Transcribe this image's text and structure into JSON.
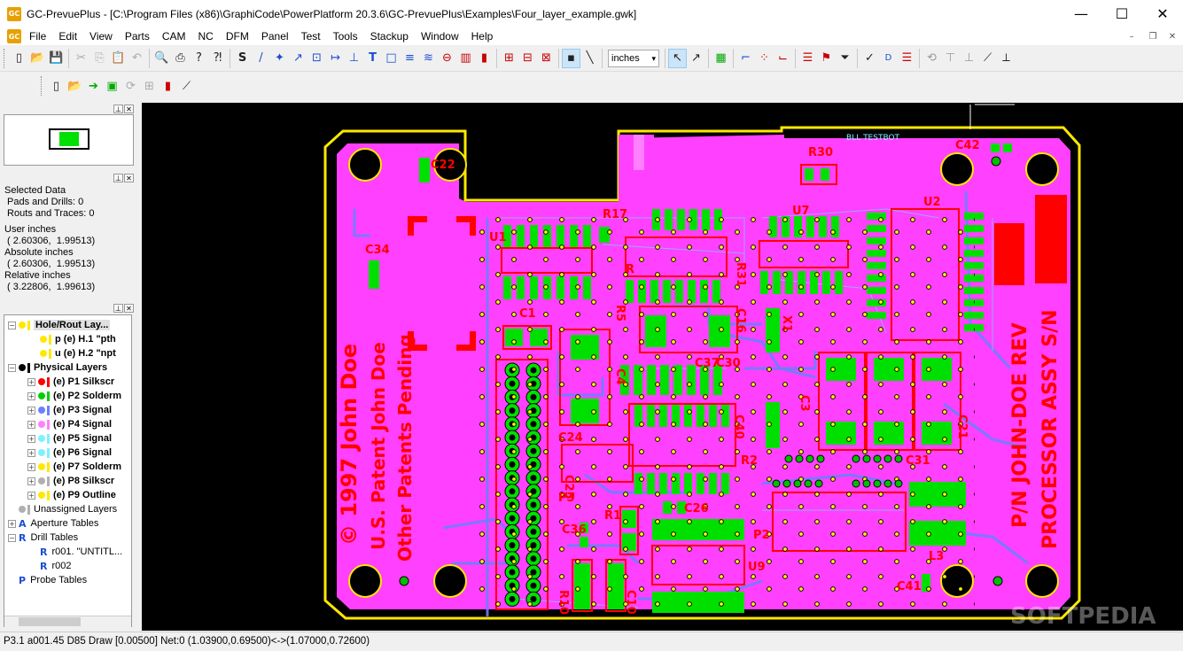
{
  "window": {
    "logo": "GC",
    "title": "GC-PrevuePlus - [C:\\Program Files (x86)\\GraphiCode\\PowerPlatform 20.3.6\\GC-PrevuePlus\\Examples\\Four_layer_example.gwk]",
    "minimize": "—",
    "maximize": "☐",
    "close": "✕"
  },
  "menu": [
    "File",
    "Edit",
    "View",
    "Parts",
    "CAM",
    "NC",
    "DFM",
    "Panel",
    "Test",
    "Tools",
    "Stackup",
    "Window",
    "Help"
  ],
  "toolbar": {
    "units_value": "inches",
    "units_arrow": "▾",
    "icons_row1a": [
      "▯",
      "📂",
      "💾"
    ],
    "icons_row1b": [
      "✂",
      "⎘",
      "📋",
      "↶"
    ],
    "icons_row1c": [
      "🔍",
      "⎙",
      "?",
      "⁈"
    ],
    "icons_row1d": [
      "S",
      "/",
      "✦",
      "↗",
      "⊡",
      "↦",
      "⊥",
      "T",
      "□",
      "≡",
      "≋",
      "⊖",
      "▥",
      "▮"
    ],
    "icons_row1e": [
      "⊞",
      "⊟",
      "⊠"
    ],
    "icons_row1f": [
      "▪",
      "╲"
    ],
    "icons_row1g": [
      "↖",
      "↗"
    ],
    "icons_row1h": [
      "▦"
    ],
    "icons_row1i": [
      "⌐",
      "⁘",
      "⌙"
    ],
    "icons_row1j": [
      "☰",
      "⚑",
      "⏷"
    ],
    "icons_row1k": [
      "✓",
      "D",
      "☰"
    ],
    "icons_row1l": [
      "⟲",
      "⊤",
      "⊥",
      "⟋",
      "⟂"
    ],
    "icons_row2": [
      "▯",
      "📂",
      "➔",
      "▣",
      "⟳",
      "⊞",
      "▮",
      "⟋"
    ]
  },
  "mdi": {
    "min": "–",
    "restore": "❐",
    "close": "✕"
  },
  "panels": {
    "pin": "⊥",
    "close": "✕"
  },
  "selected_info": [
    "Selected Data",
    " Pads and Drills: 0",
    " Routs and Traces: 0",
    "User inches",
    " ( 2.60306,  1.99513)",
    "Absolute inches",
    " ( 2.60306,  1.99513)",
    "Relative inches",
    " ( 3.22806,  1.99613)"
  ],
  "tree": [
    {
      "label": "Hole/Rout Lay...",
      "color": "#ffe800",
      "bold": true,
      "level": 0,
      "exp": "−"
    },
    {
      "label": "p (e) H.1 \"pth",
      "color": "#ffe800",
      "bold": true,
      "level": 1,
      "exp": ""
    },
    {
      "label": "u (e) H.2 \"npt",
      "color": "#ffe800",
      "bold": true,
      "level": 1,
      "exp": ""
    },
    {
      "label": "Physical Layers",
      "color": "#000000",
      "bold": true,
      "level": 0,
      "exp": "−"
    },
    {
      "label": "(e) P1 Silkscr",
      "color": "#ff0000",
      "bold": true,
      "level": 1,
      "exp": "+"
    },
    {
      "label": "(e) P2 Solderm",
      "color": "#00d000",
      "bold": true,
      "level": 1,
      "exp": "+"
    },
    {
      "label": "(e) P3 Signal",
      "color": "#6a80ff",
      "bold": true,
      "level": 1,
      "exp": "+"
    },
    {
      "label": "(e) P4 Signal",
      "color": "#ff80ff",
      "bold": true,
      "level": 1,
      "exp": "+"
    },
    {
      "label": "(e) P5 Signal",
      "color": "#80f0ff",
      "bold": true,
      "level": 1,
      "exp": "+"
    },
    {
      "label": "(e) P6 Signal",
      "color": "#80f0ff",
      "bold": true,
      "level": 1,
      "exp": "+"
    },
    {
      "label": "(e) P7 Solderm",
      "color": "#ffe800",
      "bold": true,
      "level": 1,
      "exp": "+"
    },
    {
      "label": "(e) P8 Silkscr",
      "color": "#b0b0b0",
      "bold": true,
      "level": 1,
      "exp": "+"
    },
    {
      "label": "(e) P9 Outline",
      "color": "#ffe800",
      "bold": true,
      "level": 1,
      "exp": "+"
    },
    {
      "label": "Unassigned Layers",
      "color": "#b0b0b0",
      "bold": false,
      "level": 0,
      "exp": ""
    },
    {
      "label": "Aperture Tables",
      "color": "",
      "bold": false,
      "level": 0,
      "exp": "+",
      "icon": "A"
    },
    {
      "label": "Drill Tables",
      "color": "",
      "bold": false,
      "level": 0,
      "exp": "−",
      "icon": "R"
    },
    {
      "label": "r001. \"UNTITL...",
      "color": "",
      "bold": false,
      "level": 1,
      "exp": "",
      "icon": "R"
    },
    {
      "label": "r002",
      "color": "",
      "bold": false,
      "level": 1,
      "exp": "",
      "icon": "R"
    },
    {
      "label": "Probe Tables",
      "color": "",
      "bold": false,
      "level": 0,
      "exp": "",
      "icon": "P"
    }
  ],
  "pcb": {
    "silk": [
      {
        "t": "U1",
        "c": "u1"
      },
      {
        "t": "C22",
        "c": "c22"
      },
      {
        "t": "C34",
        "c": "c34"
      },
      {
        "t": "R17",
        "c": "r17"
      },
      {
        "t": "R30",
        "c": "r30"
      },
      {
        "t": "C42",
        "c": "c42"
      },
      {
        "t": "U7",
        "c": "u7"
      },
      {
        "t": "U2",
        "c": "u2"
      },
      {
        "t": "R",
        "c": "r"
      },
      {
        "t": "R31",
        "c": "r31"
      },
      {
        "t": "C1",
        "c": "c1"
      },
      {
        "t": "R5",
        "c": "r5"
      },
      {
        "t": "C16",
        "c": "c16"
      },
      {
        "t": "X1",
        "c": "x1"
      },
      {
        "t": "C4",
        "c": "c4"
      },
      {
        "t": "C37",
        "c": "c37"
      },
      {
        "t": "C30",
        "c": "c30"
      },
      {
        "t": "C3",
        "c": "c3"
      },
      {
        "t": "C40",
        "c": "c40"
      },
      {
        "t": "C24",
        "c": "c24"
      },
      {
        "t": "R2",
        "c": "r2"
      },
      {
        "t": "C31",
        "c": "c31"
      },
      {
        "t": "P3",
        "c": "p3"
      },
      {
        "t": "C26",
        "c": "c26"
      },
      {
        "t": "R1",
        "c": "r1"
      },
      {
        "t": "C36",
        "c": "c36"
      },
      {
        "t": "P2",
        "c": "p2"
      },
      {
        "t": "U9",
        "c": "u9"
      },
      {
        "t": "L3",
        "c": "l3"
      },
      {
        "t": "R10",
        "c": "r10"
      },
      {
        "t": "C10",
        "c": "c10"
      },
      {
        "t": "C41",
        "c": "c41"
      },
      {
        "t": "C21",
        "c": "c21"
      },
      {
        "t": "C25",
        "c": "c25"
      }
    ],
    "text_copyright": "© 1997 John Doe",
    "text_patent": "U.S. Patent John Doe",
    "text_pending": "Other Patents Pending",
    "text_pn": "P/N JOHN-DOE REV",
    "text_assy": "PROCESSOR ASSY S/N",
    "label_top": "BLL TESTBOT"
  },
  "watermark": "SOFTPEDIA",
  "status": "P3.1 a001.45 D85 Draw [0.00500] Net:0 (1.03900,0.69500)<->(1.07000,0.72600)"
}
